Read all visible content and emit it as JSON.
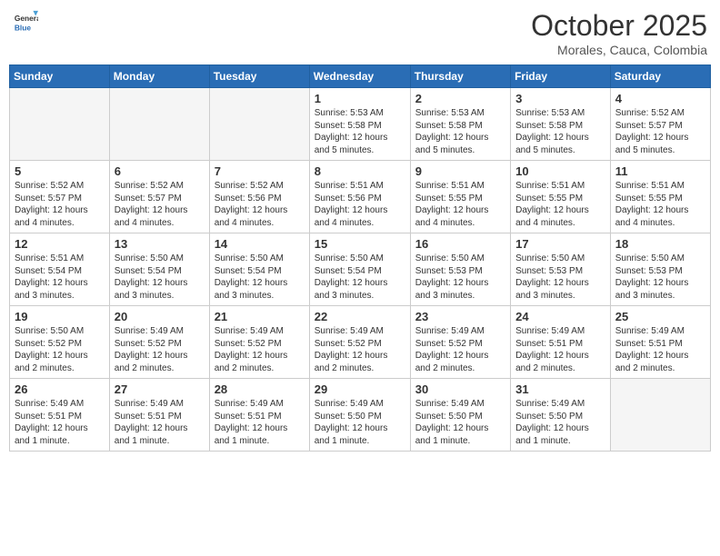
{
  "header": {
    "logo_line1": "General",
    "logo_line2": "Blue",
    "month": "October 2025",
    "location": "Morales, Cauca, Colombia"
  },
  "weekdays": [
    "Sunday",
    "Monday",
    "Tuesday",
    "Wednesday",
    "Thursday",
    "Friday",
    "Saturday"
  ],
  "weeks": [
    [
      {
        "day": "",
        "info": ""
      },
      {
        "day": "",
        "info": ""
      },
      {
        "day": "",
        "info": ""
      },
      {
        "day": "1",
        "info": "Sunrise: 5:53 AM\nSunset: 5:58 PM\nDaylight: 12 hours\nand 5 minutes."
      },
      {
        "day": "2",
        "info": "Sunrise: 5:53 AM\nSunset: 5:58 PM\nDaylight: 12 hours\nand 5 minutes."
      },
      {
        "day": "3",
        "info": "Sunrise: 5:53 AM\nSunset: 5:58 PM\nDaylight: 12 hours\nand 5 minutes."
      },
      {
        "day": "4",
        "info": "Sunrise: 5:52 AM\nSunset: 5:57 PM\nDaylight: 12 hours\nand 5 minutes."
      }
    ],
    [
      {
        "day": "5",
        "info": "Sunrise: 5:52 AM\nSunset: 5:57 PM\nDaylight: 12 hours\nand 4 minutes."
      },
      {
        "day": "6",
        "info": "Sunrise: 5:52 AM\nSunset: 5:57 PM\nDaylight: 12 hours\nand 4 minutes."
      },
      {
        "day": "7",
        "info": "Sunrise: 5:52 AM\nSunset: 5:56 PM\nDaylight: 12 hours\nand 4 minutes."
      },
      {
        "day": "8",
        "info": "Sunrise: 5:51 AM\nSunset: 5:56 PM\nDaylight: 12 hours\nand 4 minutes."
      },
      {
        "day": "9",
        "info": "Sunrise: 5:51 AM\nSunset: 5:55 PM\nDaylight: 12 hours\nand 4 minutes."
      },
      {
        "day": "10",
        "info": "Sunrise: 5:51 AM\nSunset: 5:55 PM\nDaylight: 12 hours\nand 4 minutes."
      },
      {
        "day": "11",
        "info": "Sunrise: 5:51 AM\nSunset: 5:55 PM\nDaylight: 12 hours\nand 4 minutes."
      }
    ],
    [
      {
        "day": "12",
        "info": "Sunrise: 5:51 AM\nSunset: 5:54 PM\nDaylight: 12 hours\nand 3 minutes."
      },
      {
        "day": "13",
        "info": "Sunrise: 5:50 AM\nSunset: 5:54 PM\nDaylight: 12 hours\nand 3 minutes."
      },
      {
        "day": "14",
        "info": "Sunrise: 5:50 AM\nSunset: 5:54 PM\nDaylight: 12 hours\nand 3 minutes."
      },
      {
        "day": "15",
        "info": "Sunrise: 5:50 AM\nSunset: 5:54 PM\nDaylight: 12 hours\nand 3 minutes."
      },
      {
        "day": "16",
        "info": "Sunrise: 5:50 AM\nSunset: 5:53 PM\nDaylight: 12 hours\nand 3 minutes."
      },
      {
        "day": "17",
        "info": "Sunrise: 5:50 AM\nSunset: 5:53 PM\nDaylight: 12 hours\nand 3 minutes."
      },
      {
        "day": "18",
        "info": "Sunrise: 5:50 AM\nSunset: 5:53 PM\nDaylight: 12 hours\nand 3 minutes."
      }
    ],
    [
      {
        "day": "19",
        "info": "Sunrise: 5:50 AM\nSunset: 5:52 PM\nDaylight: 12 hours\nand 2 minutes."
      },
      {
        "day": "20",
        "info": "Sunrise: 5:49 AM\nSunset: 5:52 PM\nDaylight: 12 hours\nand 2 minutes."
      },
      {
        "day": "21",
        "info": "Sunrise: 5:49 AM\nSunset: 5:52 PM\nDaylight: 12 hours\nand 2 minutes."
      },
      {
        "day": "22",
        "info": "Sunrise: 5:49 AM\nSunset: 5:52 PM\nDaylight: 12 hours\nand 2 minutes."
      },
      {
        "day": "23",
        "info": "Sunrise: 5:49 AM\nSunset: 5:52 PM\nDaylight: 12 hours\nand 2 minutes."
      },
      {
        "day": "24",
        "info": "Sunrise: 5:49 AM\nSunset: 5:51 PM\nDaylight: 12 hours\nand 2 minutes."
      },
      {
        "day": "25",
        "info": "Sunrise: 5:49 AM\nSunset: 5:51 PM\nDaylight: 12 hours\nand 2 minutes."
      }
    ],
    [
      {
        "day": "26",
        "info": "Sunrise: 5:49 AM\nSunset: 5:51 PM\nDaylight: 12 hours\nand 1 minute."
      },
      {
        "day": "27",
        "info": "Sunrise: 5:49 AM\nSunset: 5:51 PM\nDaylight: 12 hours\nand 1 minute."
      },
      {
        "day": "28",
        "info": "Sunrise: 5:49 AM\nSunset: 5:51 PM\nDaylight: 12 hours\nand 1 minute."
      },
      {
        "day": "29",
        "info": "Sunrise: 5:49 AM\nSunset: 5:50 PM\nDaylight: 12 hours\nand 1 minute."
      },
      {
        "day": "30",
        "info": "Sunrise: 5:49 AM\nSunset: 5:50 PM\nDaylight: 12 hours\nand 1 minute."
      },
      {
        "day": "31",
        "info": "Sunrise: 5:49 AM\nSunset: 5:50 PM\nDaylight: 12 hours\nand 1 minute."
      },
      {
        "day": "",
        "info": ""
      }
    ]
  ]
}
